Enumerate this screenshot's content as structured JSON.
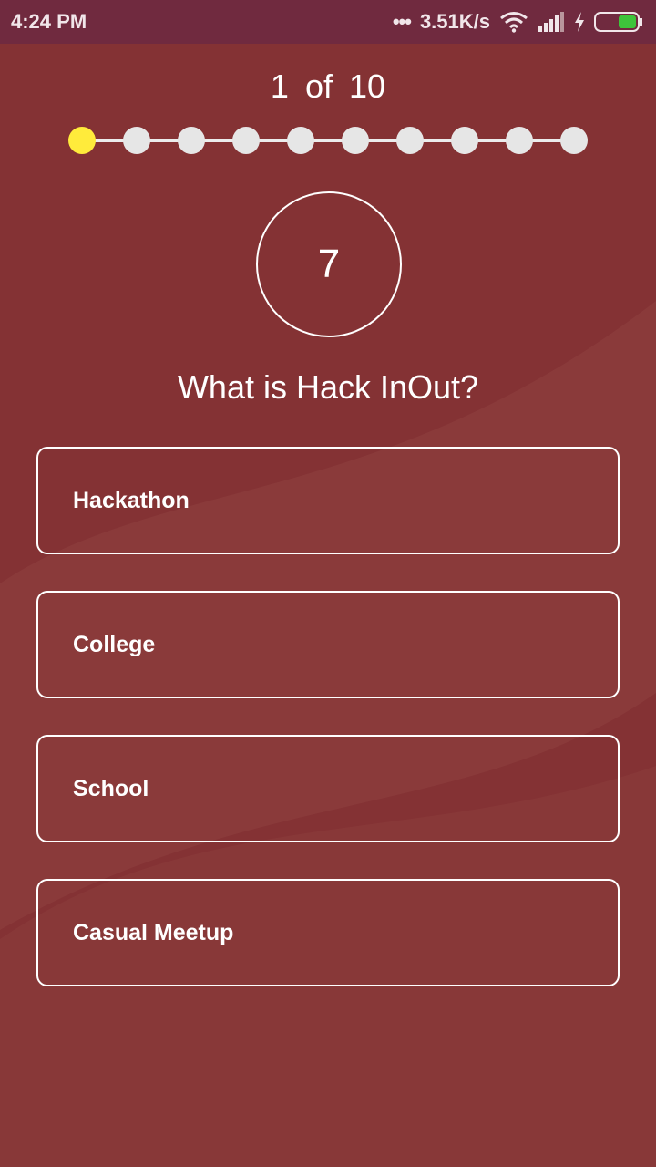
{
  "status_bar": {
    "time": "4:24 PM",
    "network_speed": "3.51K/s",
    "dots": "•••",
    "icons": [
      "wifi-icon",
      "signal-icon",
      "charging-bolt-icon",
      "battery-icon"
    ],
    "battery_color": "#3ec43b"
  },
  "quiz": {
    "progress": {
      "current": "1",
      "of": "of",
      "total": "10"
    },
    "timer": "7",
    "question": "What is Hack InOut?",
    "options": [
      {
        "label": "Hackathon"
      },
      {
        "label": "College"
      },
      {
        "label": "School"
      },
      {
        "label": "Casual Meetup"
      }
    ]
  },
  "colors": {
    "background": "#843234",
    "status_bar": "#702a3f",
    "active_step": "#ffeb3b",
    "inactive_step": "#e6e6e6"
  }
}
